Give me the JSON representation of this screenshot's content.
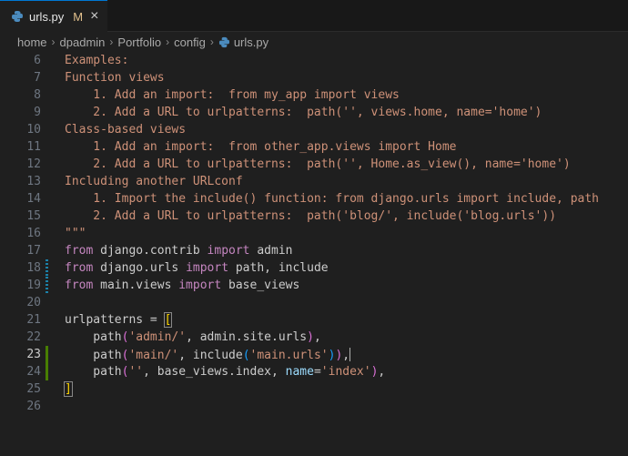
{
  "tab": {
    "filename": "urls.py",
    "modified": "M",
    "close": "×"
  },
  "breadcrumb": [
    "home",
    "dpadmin",
    "Portfolio",
    "config",
    "urls.py"
  ],
  "lines": [
    {
      "n": "6",
      "mark": "",
      "segs": [
        [
          "s",
          "Examples:"
        ]
      ]
    },
    {
      "n": "7",
      "mark": "",
      "segs": [
        [
          "s",
          "Function views"
        ]
      ]
    },
    {
      "n": "8",
      "mark": "",
      "segs": [
        [
          "s",
          "    1. Add an import:  from my_app import views"
        ]
      ]
    },
    {
      "n": "9",
      "mark": "",
      "segs": [
        [
          "s",
          "    2. Add a URL to urlpatterns:  path('', views.home, name='home')"
        ]
      ]
    },
    {
      "n": "10",
      "mark": "",
      "segs": [
        [
          "s",
          "Class-based views"
        ]
      ]
    },
    {
      "n": "11",
      "mark": "",
      "segs": [
        [
          "s",
          "    1. Add an import:  from other_app.views import Home"
        ]
      ]
    },
    {
      "n": "12",
      "mark": "",
      "segs": [
        [
          "s",
          "    2. Add a URL to urlpatterns:  path('', Home.as_view(), name='home')"
        ]
      ]
    },
    {
      "n": "13",
      "mark": "",
      "segs": [
        [
          "s",
          "Including another URLconf"
        ]
      ]
    },
    {
      "n": "14",
      "mark": "",
      "segs": [
        [
          "s",
          "    1. Import the include() function: from django.urls import include, path"
        ]
      ]
    },
    {
      "n": "15",
      "mark": "",
      "segs": [
        [
          "s",
          "    2. Add a URL to urlpatterns:  path('blog/', include('blog.urls'))"
        ]
      ]
    },
    {
      "n": "16",
      "mark": "",
      "segs": [
        [
          "s",
          "\"\"\""
        ]
      ]
    },
    {
      "n": "17",
      "mark": "",
      "segs": [
        [
          "k",
          "from"
        ],
        [
          "c",
          " django.contrib "
        ],
        [
          "k",
          "import"
        ],
        [
          "c",
          " admin"
        ]
      ]
    },
    {
      "n": "18",
      "mark": "mod",
      "segs": [
        [
          "k",
          "from"
        ],
        [
          "c",
          " django.urls "
        ],
        [
          "k",
          "import"
        ],
        [
          "c",
          " path, include"
        ]
      ]
    },
    {
      "n": "19",
      "mark": "mod",
      "segs": [
        [
          "k",
          "from"
        ],
        [
          "c",
          " main.views "
        ],
        [
          "k",
          "import"
        ],
        [
          "c",
          " base_views"
        ]
      ]
    },
    {
      "n": "20",
      "mark": "",
      "segs": []
    },
    {
      "n": "21",
      "mark": "",
      "segs": [
        [
          "c",
          "urlpatterns = "
        ],
        [
          "b1 bbox",
          "["
        ]
      ]
    },
    {
      "n": "22",
      "mark": "",
      "segs": [
        [
          "c",
          "    path"
        ],
        [
          "b2",
          "("
        ],
        [
          "s",
          "'admin/'"
        ],
        [
          "c",
          ", admin.site.urls"
        ],
        [
          "b2",
          ")"
        ],
        [
          "c",
          ","
        ]
      ]
    },
    {
      "n": "23",
      "mark": "add",
      "current": true,
      "segs": [
        [
          "c",
          "    path"
        ],
        [
          "b2",
          "("
        ],
        [
          "s",
          "'main/'"
        ],
        [
          "c",
          ", include"
        ],
        [
          "b3",
          "("
        ],
        [
          "s",
          "'main.urls'"
        ],
        [
          "b3",
          ")"
        ],
        [
          "b2",
          ")"
        ],
        [
          "c",
          ","
        ],
        [
          "cursor",
          ""
        ]
      ]
    },
    {
      "n": "24",
      "mark": "add",
      "segs": [
        [
          "c",
          "    path"
        ],
        [
          "b2",
          "("
        ],
        [
          "s",
          "''"
        ],
        [
          "c",
          ", base_views.index, "
        ],
        [
          "p",
          "name"
        ],
        [
          "c",
          "="
        ],
        [
          "s",
          "'index'"
        ],
        [
          "b2",
          ")"
        ],
        [
          "c",
          ","
        ]
      ]
    },
    {
      "n": "25",
      "mark": "",
      "segs": [
        [
          "b1 bbox",
          "]"
        ]
      ]
    },
    {
      "n": "26",
      "mark": "",
      "segs": []
    }
  ]
}
